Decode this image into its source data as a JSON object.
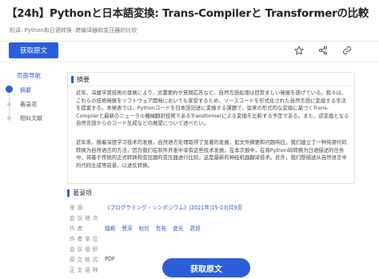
{
  "page": {
    "title": "【24h】Pythonと日本語変換: Trans-Compilerと Transformerの比較",
    "keywords_label": "机译:",
    "keywords": [
      "Python和日语转换",
      "跨编译器和变压器的比较"
    ],
    "keyword_sep": ":"
  },
  "toolbar": {
    "fetch_label": "获取原文",
    "icons": [
      "star-icon",
      "share-icon",
      "link-icon"
    ]
  },
  "nav": {
    "title": "页面导航",
    "items": [
      "摘要",
      "著录项",
      "相似文献"
    ]
  },
  "abstract": {
    "heading": "摘要",
    "paragraphs": [
      "近年、深層学習技術の發展により、文書要約や質問応答など、自然言語処理は目覚ましい発展を遂げている。我々は、これらの技術発展をソフトウェア開発においても享受するため、ソースコードを形式化された自然言語に変換する手法を提案する。本発表では、Pythonコードを日本語記述に変換する課題で、従来の形式的な変換に基づくTrans-Compilerと最新のニューラル機械翻訳技術であるTransformerによる変換を比較する予定である。また、逆変換となる自然言語からのコード生成などの展望について述べたい。",
      "近年来，随着深度学习技术的发展，自然语言处理取得了显著的发展，如文件摘要和问题响应。我们建立了一种将源代码转换为自然语言的方法，因为我们在软件开发中享有这些技术发展。在本次报中，在将Python码转换为日语描述的任务中，将基于传统的正式转换和变压器的变压器进行比较，这是最新的神经机器翻译技术。此外，我们想描述从自然语言中的代码生成等前景，以进反转换。"
    ]
  },
  "meta": {
    "heading": "著录项",
    "rows": [
      {
        "key": "来源",
        "value": "《プログラミング・シンポジウム》|2021年|15-23|共9页",
        "type": "link"
      },
      {
        "key": "会议地点",
        "value": "",
        "type": "text"
      },
      {
        "key": "作者",
        "value": "",
        "type": "authors",
        "authors": [
          "縫嶋",
          "慧深",
          "秋信",
          "有祐",
          "倉光",
          "君郎"
        ]
      },
      {
        "key": "作者单位",
        "value": "",
        "type": "text"
      },
      {
        "key": "会议组织",
        "value": "",
        "type": "text"
      },
      {
        "key": "原文格式",
        "value": "PDF",
        "type": "text"
      },
      {
        "key": "正文语种",
        "value": "",
        "type": "text"
      }
    ]
  },
  "bottom_button": {
    "label": "获取原文"
  },
  "colors": {
    "accent": "#2b5fd9",
    "text": "#333333",
    "muted": "#888888"
  }
}
